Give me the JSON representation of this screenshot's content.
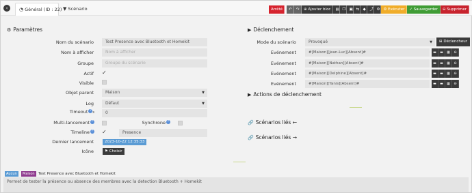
{
  "tabs": [
    {
      "label": "Général (ID : 22)",
      "icon": "gauge-icon"
    },
    {
      "label": "Scénario",
      "icon": "filter-icon"
    }
  ],
  "toolbar": {
    "stop_label": "Arrêté",
    "add_block_label": "Ajouter bloc",
    "run_label": "Exécuter",
    "save_label": "Sauvegarder",
    "delete_label": "Supprimer",
    "colors": {
      "stop": "#d6232e",
      "run": "#f0ad2a",
      "save": "#3f9c35",
      "delete": "#c8232e"
    }
  },
  "params": {
    "title": "Paramètres",
    "scenario_name_label": "Nom du scénario",
    "scenario_name_value": "Test Presence avec Bluetooth et Homekit",
    "display_name_label": "Nom à afficher",
    "display_name_placeholder": "Nom à afficher",
    "group_label": "Groupe",
    "group_placeholder": "Groupe du scénario",
    "active_label": "Actif",
    "visible_label": "Visible",
    "parent_label": "Objet parent",
    "parent_value": "Maison",
    "log_label": "Log",
    "log_value": "Défaut",
    "timeout_label": "Timeout",
    "timeout_unit": "s",
    "timeout_value": "0",
    "multi_label": "Multi-lancement",
    "sync_label": "Synchrone",
    "timeline_label": "Timeline",
    "timeline_value": "Presence",
    "last_run_label": "Dernier lancement",
    "last_run_value": "2023-10-22 12:35:33",
    "icon_label": "Icône",
    "choose_label": "Choisir"
  },
  "trigger": {
    "title": "Déclenchement",
    "mode_label": "Mode du scénario",
    "mode_value": "Provoqué",
    "trigger_button": "Déclencheur",
    "event_label": "Evénement",
    "events": [
      "#[Maison][Jean-Luc][Absent]#",
      "#[Maison][Nathan][Absent]#",
      "#[Maison][Delphine][Absent]#",
      "#[Maison][Yanis][Absent]#"
    ],
    "actions_title": "Actions de déclenchement",
    "linked_in": "Scénarios liés",
    "linked_out": "Scénarios liés"
  },
  "footer": {
    "badge_none": "Aucun",
    "badge_house": "Maison",
    "title": "Test Presence avec Bluetooth et Homekit",
    "description": "Permet de tester la présence ou absence des membres avec la detection Bluetooth + Homekit"
  }
}
